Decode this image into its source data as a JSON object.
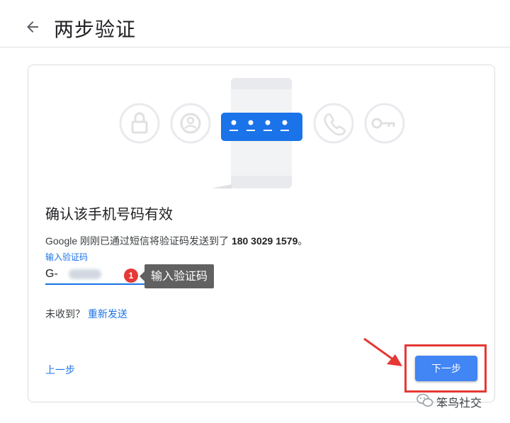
{
  "header": {
    "title": "两步验证"
  },
  "verify": {
    "heading": "确认该手机号码有效",
    "description_prefix": "Google 刚刚已通过短信将验证码发送到了 ",
    "phone_number": "180 3029 1579",
    "description_suffix": "。",
    "field_label": "输入验证码",
    "code_value": "G-",
    "badge_number": "1",
    "tooltip_text": "输入验证码",
    "resend_prompt": "未收到？",
    "resend_link": "重新发送",
    "prev_label": "上一步",
    "next_label": "下一步"
  },
  "watermark": {
    "text": "笨鸟社交"
  },
  "colors": {
    "accent": "#1a73e8",
    "button": "#4285f4",
    "annotation": "#e53935",
    "illustration_blue": "#1a73e8"
  },
  "icons": [
    "back-arrow-icon",
    "lock-icon",
    "account-icon",
    "phone-icon",
    "key-icon",
    "wechat-icon"
  ]
}
